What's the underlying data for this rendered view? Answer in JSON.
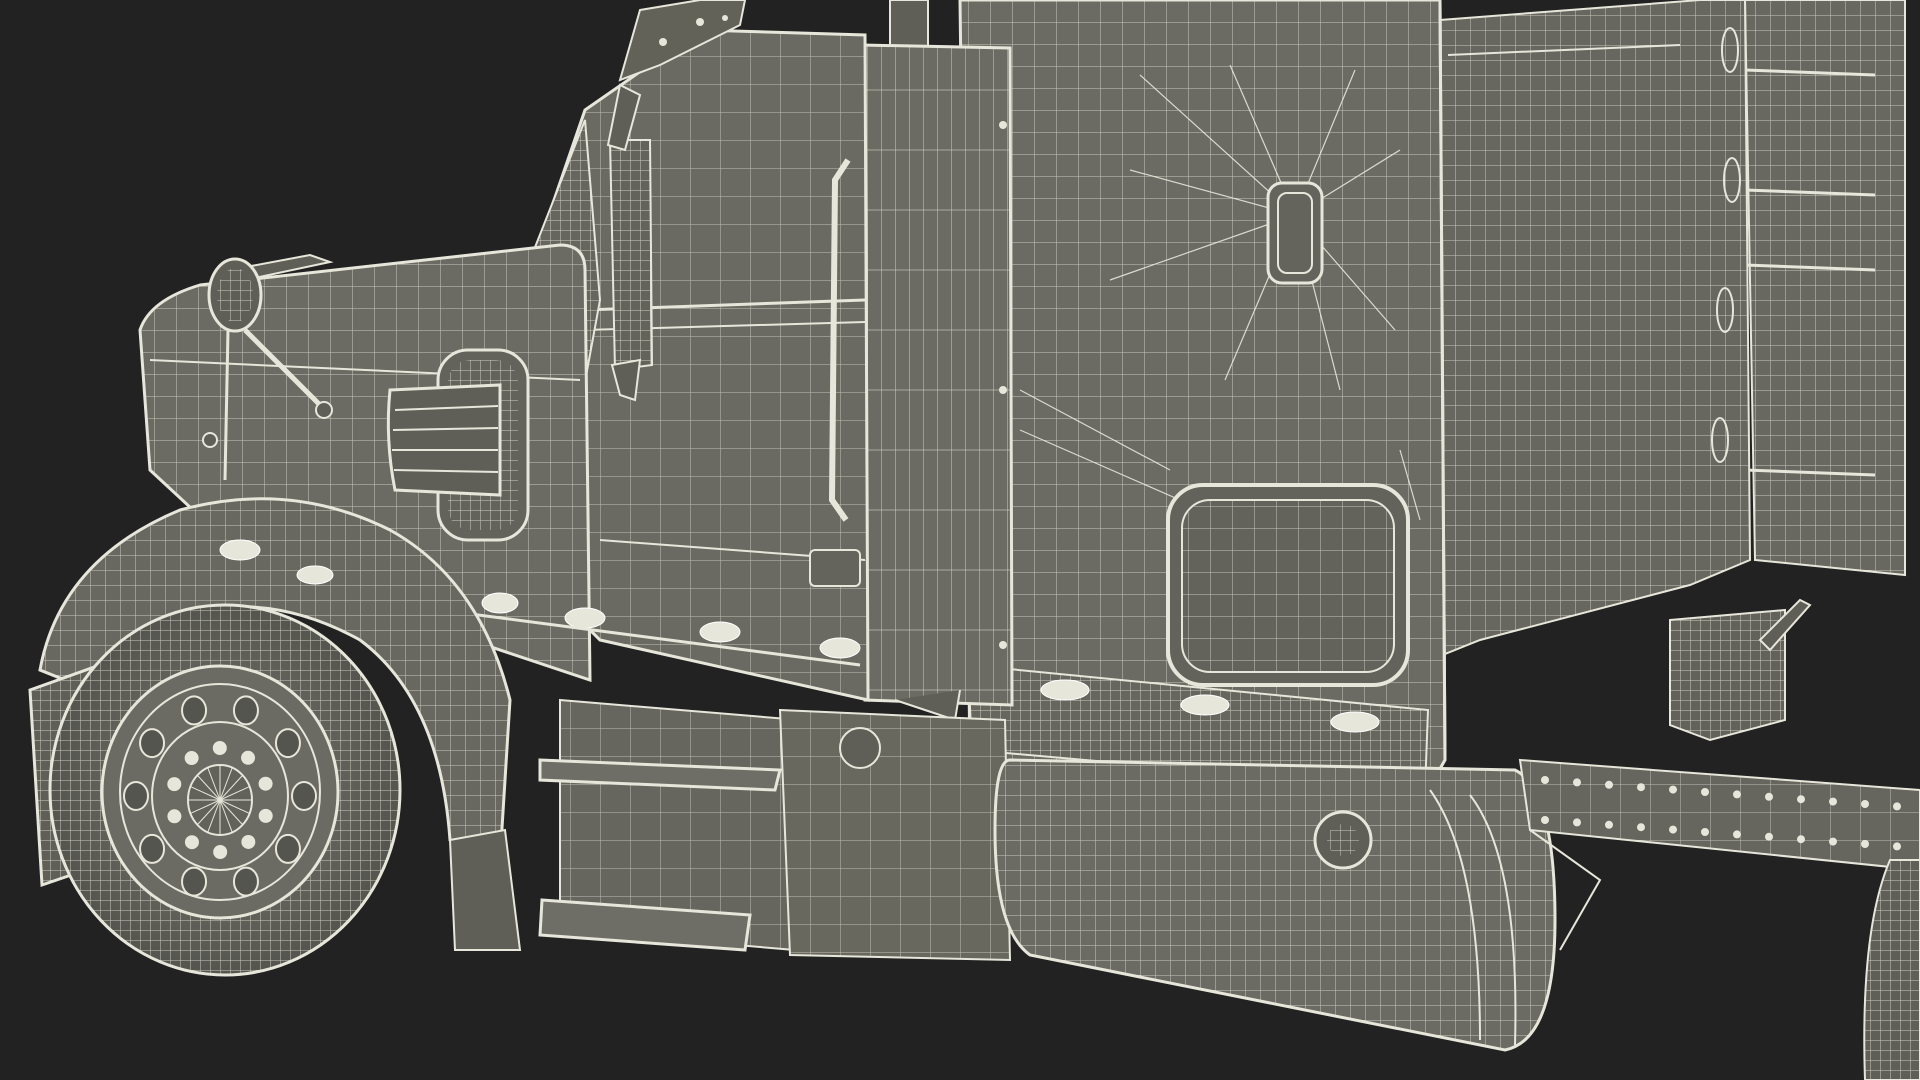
{
  "scene": {
    "subject": "semi-truck-cab-wireframe",
    "background_color": "#222222",
    "body_color": "#6b6b63",
    "body_shade_color": "#5f5f58",
    "wire_color": "#e6e6da",
    "wire_dim_color": "#c9c9bc"
  }
}
